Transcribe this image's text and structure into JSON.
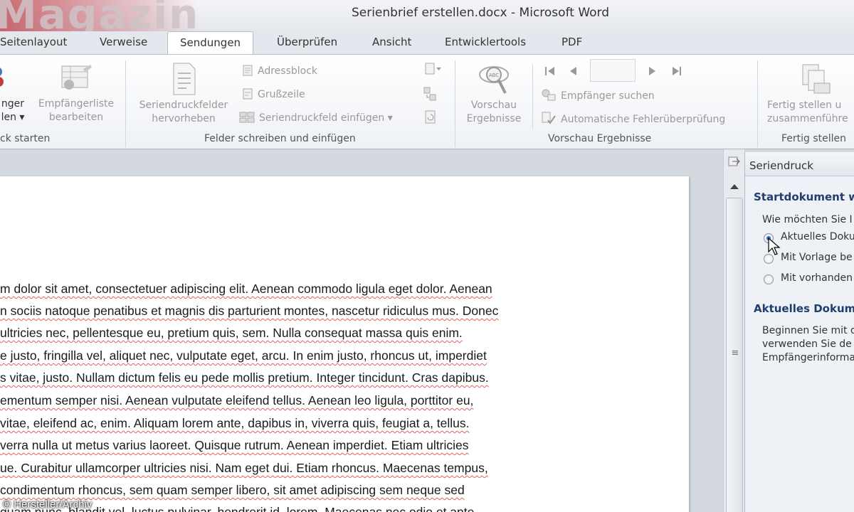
{
  "window": {
    "title": "Serienbrief erstellen.docx  -  Microsoft Word",
    "watermark": "Magazin"
  },
  "tabs": [
    {
      "label": "Seitenlayout"
    },
    {
      "label": "Verweise"
    },
    {
      "label": "Sendungen",
      "active": true
    },
    {
      "label": "Überprüfen"
    },
    {
      "label": "Ansicht"
    },
    {
      "label": "Entwicklertools"
    },
    {
      "label": "PDF"
    }
  ],
  "ribbon": {
    "start_group": {
      "label": "ck starten",
      "recipients_line1": "nger",
      "recipients_line2": "len ▾",
      "edit_list_line1": "Empfängerliste",
      "edit_list_line2": "bearbeiten"
    },
    "fields_group": {
      "label": "Felder schreiben und einfügen",
      "highlight_line1": "Seriendruckfelder",
      "highlight_line2": "hervorheben",
      "address_block": "Adressblock",
      "greeting_line": "Grußzeile",
      "insert_field": "Seriendruckfeld einfügen ▾"
    },
    "preview_group": {
      "label": "Vorschau Ergebnisse",
      "preview_line1": "Vorschau",
      "preview_line2": "Ergebnisse",
      "find_recipient": "Empfänger suchen",
      "auto_check": "Automatische Fehlerüberprüfung",
      "record_value": ""
    },
    "finish_group": {
      "label": "Fertig stellen",
      "finish_line1": "Fertig stellen u",
      "finish_line2": "zusammenführe"
    }
  },
  "document": {
    "lines": [
      "m dolor sit amet, consectetuer adipiscing elit. Aenean commodo ligula eget dolor. Aenean",
      "n sociis natoque penatibus et magnis dis parturient montes, nascetur ridiculus mus. Donec",
      "ultricies nec, pellentesque eu, pretium quis, sem. Nulla consequat massa quis enim.",
      "e justo, fringilla vel, aliquet nec, vulputate eget, arcu. In enim justo, rhoncus ut, imperdiet",
      "s vitae, justo. Nullam dictum felis eu pede mollis pretium. Integer tincidunt. Cras dapibus.",
      "ementum semper nisi. Aenean vulputate eleifend tellus. Aenean leo ligula, porttitor eu,",
      "vitae, eleifend ac, enim. Aliquam lorem ante, dapibus in, viverra quis, feugiat a, tellus.",
      "verra nulla ut metus varius laoreet. Quisque rutrum. Aenean imperdiet. Etiam ultricies",
      "ue. Curabitur ullamcorper ultricies nisi. Nam eget dui. Etiam rhoncus. Maecenas tempus,",
      "condimentum rhoncus, sem quam semper libero, sit amet adipiscing sem neque sed",
      "quam nunc, blandit vel, luctus pulvinar, hendrerit id, lorem. Maecenas nec odio et ante"
    ],
    "copyright": "© Hersteller/Archiv"
  },
  "pane": {
    "title": "Seriendruck",
    "section1_title": "Startdokument w",
    "question": "Wie möchten Sie I",
    "options": [
      {
        "label": "Aktuelles Doku",
        "selected": true
      },
      {
        "label": "Mit Vorlage be",
        "selected": false
      },
      {
        "label": "Mit vorhanden",
        "selected": false
      }
    ],
    "section2_title": "Aktuelles Dokum",
    "description": [
      "Beginnen Sie mit d",
      "verwenden Sie de",
      "Empfängerinforma"
    ]
  }
}
